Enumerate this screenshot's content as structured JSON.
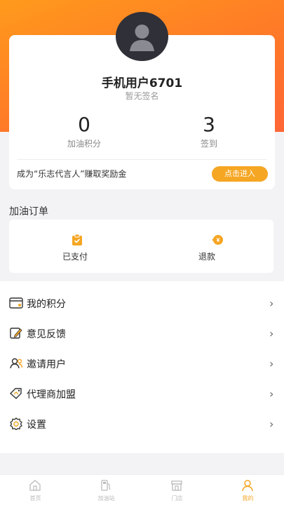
{
  "profile": {
    "username": "手机用户6701",
    "signature": "暂无签名",
    "points_value": "0",
    "points_label": "加油积分",
    "checkin_value": "3",
    "checkin_label": "签到",
    "promo_text": "成为“乐志代言人”赚取奖励金",
    "promo_button": "点击进入"
  },
  "orders": {
    "title": "加油订单",
    "items": [
      {
        "label": "已支付",
        "icon": "clipboard-check-icon"
      },
      {
        "label": "退款",
        "icon": "refund-icon"
      }
    ]
  },
  "menu": {
    "items": [
      {
        "label": "我的积分",
        "icon": "wallet-card-icon"
      },
      {
        "label": "意见反馈",
        "icon": "edit-note-icon"
      },
      {
        "label": "邀请用户",
        "icon": "invite-user-icon"
      },
      {
        "label": "代理商加盟",
        "icon": "handshake-tag-icon"
      },
      {
        "label": "设置",
        "icon": "gear-icon"
      }
    ],
    "chevron": "›"
  },
  "tabbar": {
    "items": [
      {
        "label": "首页",
        "icon": "home-icon",
        "active": false
      },
      {
        "label": "加油站",
        "icon": "fuel-pump-icon",
        "active": false
      },
      {
        "label": "门店",
        "icon": "store-icon",
        "active": false
      },
      {
        "label": "我的",
        "icon": "user-icon",
        "active": true
      }
    ]
  },
  "colors": {
    "header_gradient_start": "#ff9a1c",
    "header_gradient_end": "#ff6636",
    "accent": "#f5a623",
    "avatar_bg": "#2f3038"
  }
}
